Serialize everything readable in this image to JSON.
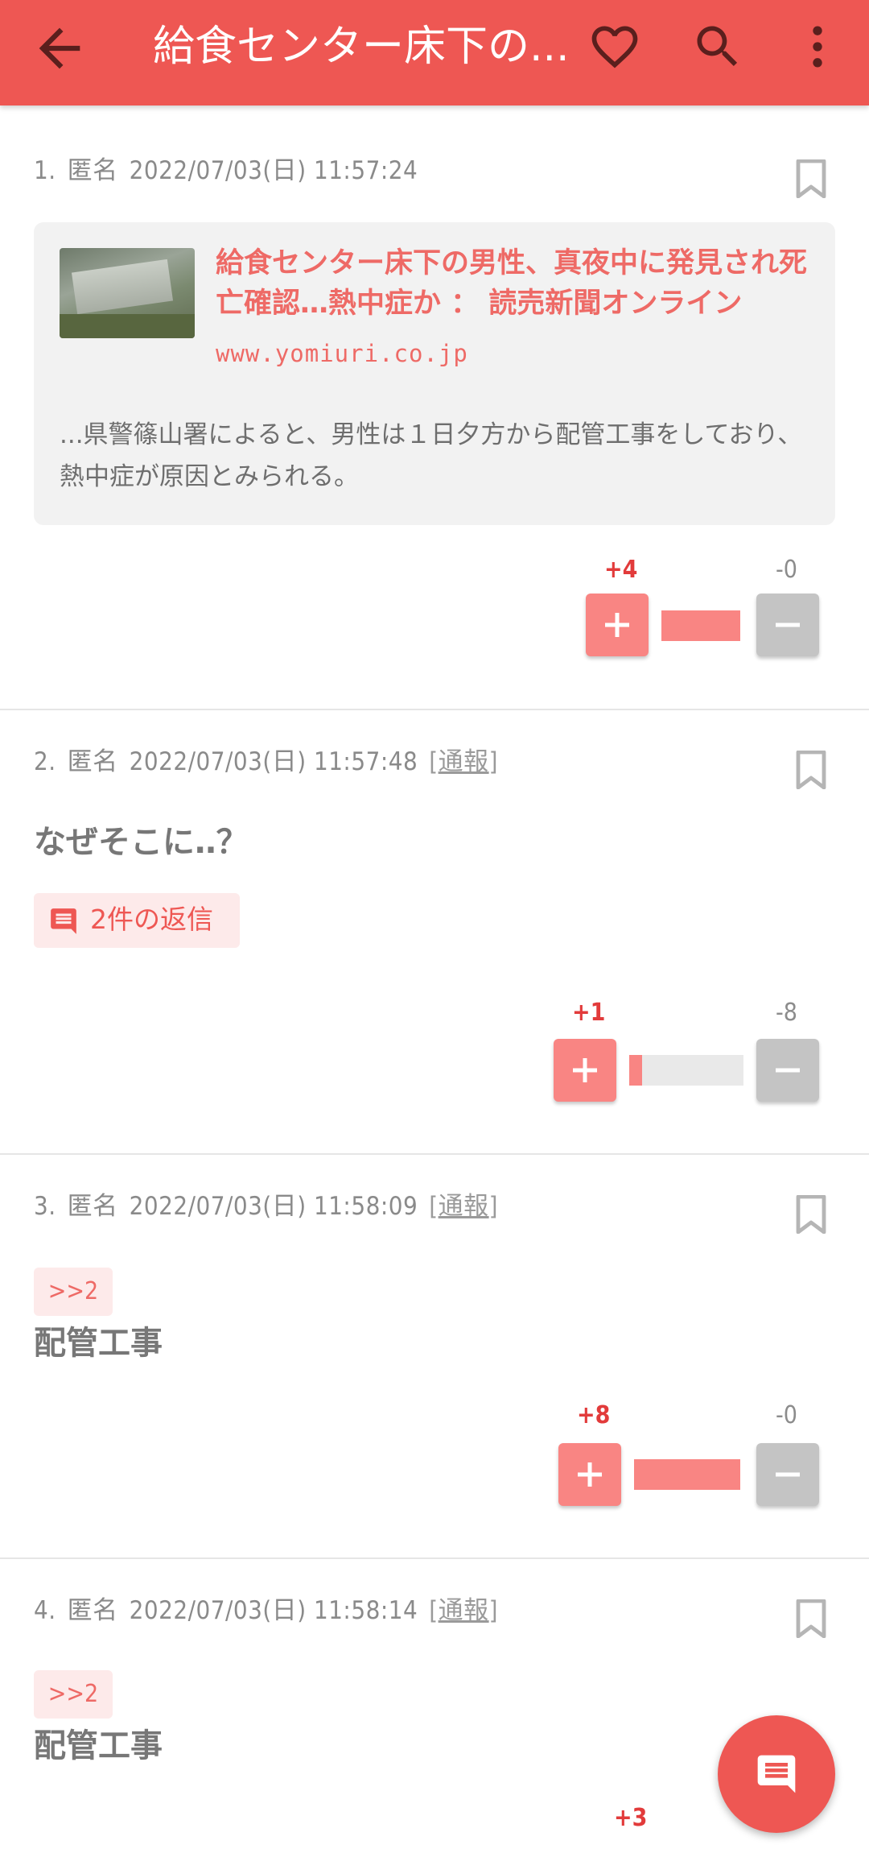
{
  "header": {
    "title": "給食センター床下の...",
    "back_icon": "arrow-left-icon",
    "favorite_icon": "heart-outline-icon",
    "search_icon": "search-icon",
    "more_icon": "more-vert-icon",
    "color": "#ee5753"
  },
  "posts": [
    {
      "number": "1.",
      "author": "匿名",
      "datetime": "2022/07/03(日) 11:57:24",
      "link": {
        "title": "給食センター床下の男性、真夜中に発見され死亡確認…熱中症か ： 読売新聞オンライン",
        "domain": "www.yomiuri.co.jp",
        "excerpt": "...県警篠山署によると、男性は１日夕方から配管工事をしており、熱中症が原因とみられる。"
      },
      "plus": "+4",
      "minus": "-0",
      "plus_ratio": 1.0
    },
    {
      "number": "2.",
      "author": "匿名",
      "datetime": "2022/07/03(日) 11:57:48",
      "report": "通報",
      "body": "なぜそこに‥？",
      "replies": "2件の返信",
      "plus": "+1",
      "minus": "-8",
      "plus_ratio": 0.11
    },
    {
      "number": "3.",
      "author": "匿名",
      "datetime": "2022/07/03(日) 11:58:09",
      "report": "通報",
      "anchor": ">>2",
      "body": "配管工事",
      "plus": "+8",
      "minus": "-0",
      "plus_ratio": 1.0
    },
    {
      "number": "4.",
      "author": "匿名",
      "datetime": "2022/07/03(日) 11:58:14",
      "report": "通報",
      "anchor": ">>2",
      "body": "配管工事",
      "plus": "+3"
    }
  ],
  "bracket_open": "[",
  "bracket_close": "]",
  "fab_icon": "comment-icon"
}
